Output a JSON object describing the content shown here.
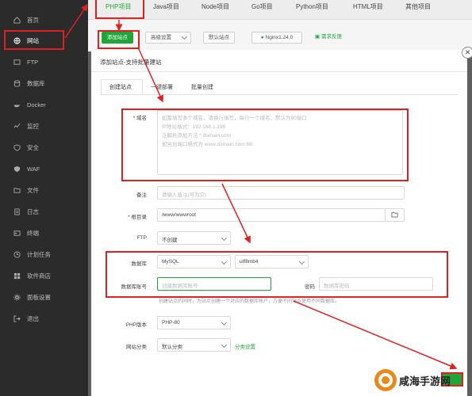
{
  "sidebar": {
    "items": [
      {
        "label": "首页",
        "icon": "home-icon"
      },
      {
        "label": "网站",
        "icon": "globe-icon"
      },
      {
        "label": "FTP",
        "icon": "ftp-icon"
      },
      {
        "label": "数据库",
        "icon": "database-icon"
      },
      {
        "label": "Docker",
        "icon": "docker-icon"
      },
      {
        "label": "监控",
        "icon": "monitor-icon"
      },
      {
        "label": "安全",
        "icon": "shield-icon"
      },
      {
        "label": "WAF",
        "icon": "waf-icon"
      },
      {
        "label": "文件",
        "icon": "folder-icon"
      },
      {
        "label": "日志",
        "icon": "log-icon"
      },
      {
        "label": "终端",
        "icon": "terminal-icon"
      },
      {
        "label": "计划任务",
        "icon": "clock-icon"
      },
      {
        "label": "软件商店",
        "icon": "store-icon"
      },
      {
        "label": "面板设置",
        "icon": "gear-icon"
      },
      {
        "label": "退出",
        "icon": "logout-icon"
      }
    ]
  },
  "project_tabs": [
    "PHP项目",
    "Java项目",
    "Node项目",
    "Go项目",
    "Python项目",
    "HTML项目",
    "其他项目"
  ],
  "toolbar": {
    "add_site": "添加站点",
    "advanced": "高级设置",
    "recycle": "默认站点",
    "nginx": "Nginx1.24.0",
    "feedback": "需求反馈"
  },
  "modal": {
    "title": "添加站点-支持批量建站",
    "tabs": [
      "创建站点",
      "一键部署",
      "批量创建"
    ],
    "domain": {
      "label": "* 域名",
      "hint_lines": [
        "如需填写多个域名，请换行填写，每行一个域名，默认为80端口",
        "IP地址格式：192.168.1.199",
        "泛解析添加方法 *.domain.com",
        "如另加端口格式为 www.domain.com:88"
      ]
    },
    "remark": {
      "label": "备注",
      "placeholder": "请输入备注(可为空)"
    },
    "root": {
      "label": "* 根目录",
      "value": "/www/wwwroot"
    },
    "ftp": {
      "label": "FTP",
      "value": "不创建"
    },
    "database": {
      "label": "数据库",
      "type": "MySQL",
      "charset": "utf8mb4"
    },
    "db_account": {
      "label": "数据库账号",
      "placeholder": "创建数据库账号"
    },
    "db_password": {
      "label": "密码",
      "placeholder": "数据库密码"
    },
    "db_hint": "创建站点的同时，为站点创建一个对应的数据库帐户，方便不同站点使用不同数据库。",
    "php": {
      "label": "PHP版本",
      "value": "PHP-80"
    },
    "category": {
      "label": "网站分类",
      "value": "默认分类",
      "link": "分类设置"
    }
  },
  "watermark": "咸海手游网",
  "colors": {
    "accent": "#20a53a",
    "highlight": "#e02020",
    "sidebar": "#2b2b2b"
  }
}
